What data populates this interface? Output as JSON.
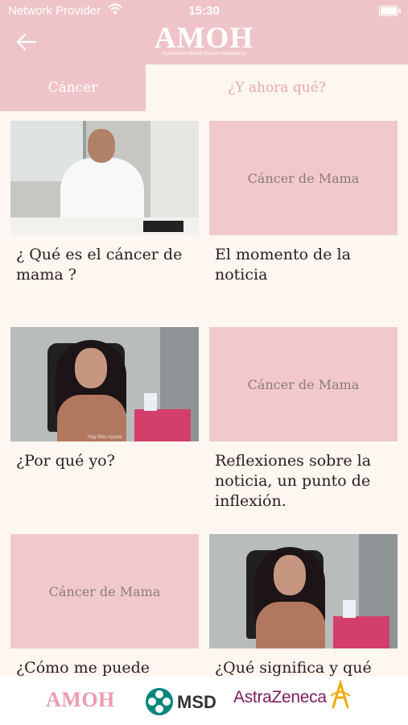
{
  "status_bar": {
    "carrier": "Network Provider",
    "time": "15:30"
  },
  "header": {
    "logo_title": "AMOH",
    "logo_subtitle": "Asociación Mama Ovario Hereditario"
  },
  "tabs": [
    {
      "label": "Cáncer",
      "active": true
    },
    {
      "label": "¿Y ahora qué?",
      "active": false
    }
  ],
  "cards": [
    {
      "title": "¿ Qué es el cáncer de mama ?",
      "thumbnail": "video-man-office"
    },
    {
      "title": "El momento de la noticia",
      "thumbnail_text": "Cáncer de Mama"
    },
    {
      "title": "¿Por qué yo?",
      "thumbnail": "video-woman-chair",
      "thumbnail_caption": "Hay Mas Ayuda"
    },
    {
      "title": "Reflexiones sobre la noticia, un punto de inflexión.",
      "thumbnail_text": "Cáncer de Mama"
    },
    {
      "title": "¿Cómo me puede",
      "thumbnail_text": "Cáncer de Mama"
    },
    {
      "title": "¿Qué significa y qué",
      "thumbnail": "video-woman-chair"
    }
  ],
  "footer": {
    "logos": [
      {
        "name": "AMOH",
        "color": "#ef9ab0"
      },
      {
        "name": "MSD",
        "color": "#00857c"
      },
      {
        "name": "AstraZeneca",
        "color": "#7b1e5e"
      }
    ]
  },
  "colors": {
    "header_pink": "#efc4c8",
    "background": "#fdf6f1",
    "tab_inactive_text": "#e8a6b6"
  }
}
